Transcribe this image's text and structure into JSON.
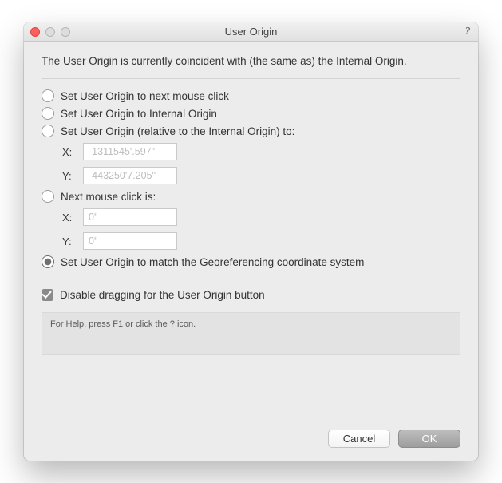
{
  "window": {
    "title": "User Origin",
    "help_glyph": "?"
  },
  "intro": "The User Origin is currently coincident with (the same as) the Internal Origin.",
  "options": {
    "next_click": "Set User Origin to next mouse click",
    "internal": "Set User Origin to Internal Origin",
    "relative": "Set User Origin (relative to the Internal Origin) to:",
    "relative_fields": {
      "x_label": "X:",
      "x_value": "-1311545'.597\"",
      "y_label": "Y:",
      "y_value": "-443250'7.205\""
    },
    "next_click_is": "Next mouse click is:",
    "next_click_fields": {
      "x_label": "X:",
      "x_value": "0\"",
      "y_label": "Y:",
      "y_value": "0\""
    },
    "georef": "Set User Origin to match the Georeferencing coordinate system",
    "selected": "georef"
  },
  "disable_drag": {
    "label": "Disable dragging for the User Origin button",
    "checked": true
  },
  "help_text": "For Help, press F1 or click the ? icon.",
  "buttons": {
    "cancel": "Cancel",
    "ok": "OK"
  }
}
